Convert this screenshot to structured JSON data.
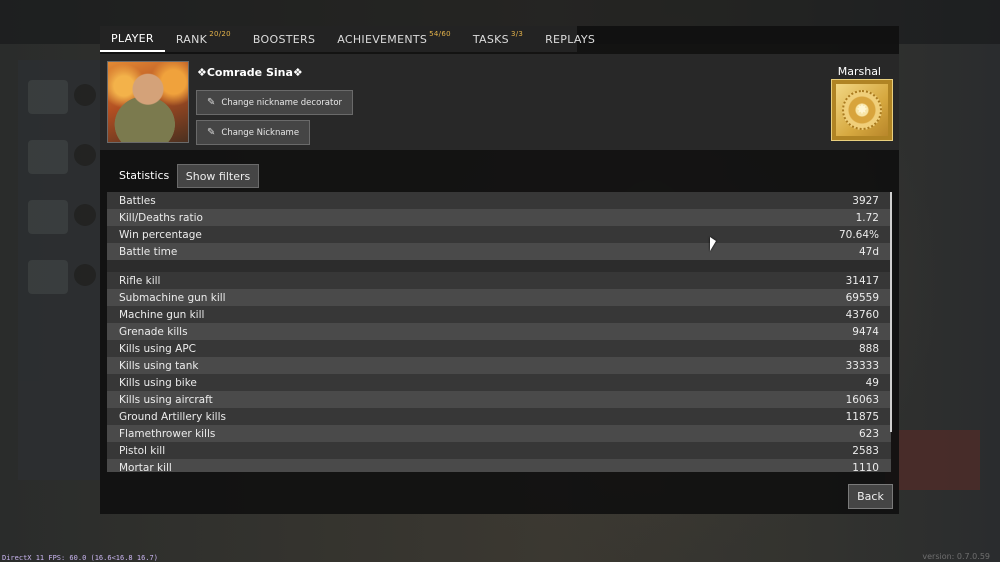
{
  "tabs": [
    {
      "label": "PLAYER",
      "badge": ""
    },
    {
      "label": "RANK",
      "badge": "20/20"
    },
    {
      "label": "BOOSTERS",
      "badge": ""
    },
    {
      "label": "ACHIEVEMENTS",
      "badge": "54/60"
    },
    {
      "label": "TASKS",
      "badge": "3/3"
    },
    {
      "label": "REPLAYS",
      "badge": ""
    }
  ],
  "profile": {
    "nickname": "❖Comrade Sina❖",
    "change_decorator_label": "Change nickname decorator",
    "change_nickname_label": "Change Nickname",
    "rank_name": "Marshal",
    "edit_icon": "pencil-icon"
  },
  "statistics": {
    "title": "Statistics",
    "filters_label": "Show filters",
    "general": [
      {
        "label": "Battles",
        "value": "3927"
      },
      {
        "label": "Kill/Deaths ratio",
        "value": "1.72"
      },
      {
        "label": "Win percentage",
        "value": "70.64%"
      },
      {
        "label": "Battle time",
        "value": "47d"
      }
    ],
    "kills": [
      {
        "label": "Rifle kill",
        "value": "31417"
      },
      {
        "label": "Submachine gun kill",
        "value": "69559"
      },
      {
        "label": "Machine gun kill",
        "value": "43760"
      },
      {
        "label": "Grenade kills",
        "value": "9474"
      },
      {
        "label": "Kills using APC",
        "value": "888"
      },
      {
        "label": "Kills using tank",
        "value": "33333"
      },
      {
        "label": "Kills using bike",
        "value": "49"
      },
      {
        "label": "Kills using aircraft",
        "value": "16063"
      },
      {
        "label": "Ground Artillery kills",
        "value": "11875"
      },
      {
        "label": "Flamethrower kills",
        "value": "623"
      },
      {
        "label": "Pistol kill",
        "value": "2583"
      },
      {
        "label": "Mortar kill",
        "value": "1110"
      }
    ]
  },
  "back_label": "Back",
  "footer": {
    "fps": "DirectX 11 FPS: 60.0 (16.6<16.8 16.7)",
    "version": "version: 0.7.0.59"
  }
}
